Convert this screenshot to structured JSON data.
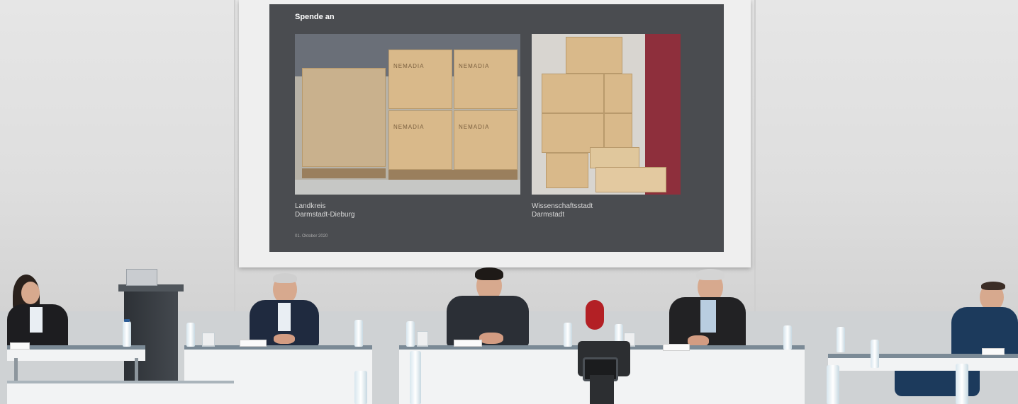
{
  "slide": {
    "title": "Spende an",
    "left_caption_line1": "Landkreis",
    "left_caption_line2": "Darmstadt-Dieburg",
    "right_caption_line1": "Wissenschaftsstadt",
    "right_caption_line2": "Darmstadt",
    "date": "01. Oktober 2020",
    "box_brand": "NEMADIA"
  },
  "colors": {
    "slide_background": "#4a4c50",
    "wall": "#e2e2e2",
    "table_edge": "#7b8a96",
    "mic_red": "#b32025"
  }
}
